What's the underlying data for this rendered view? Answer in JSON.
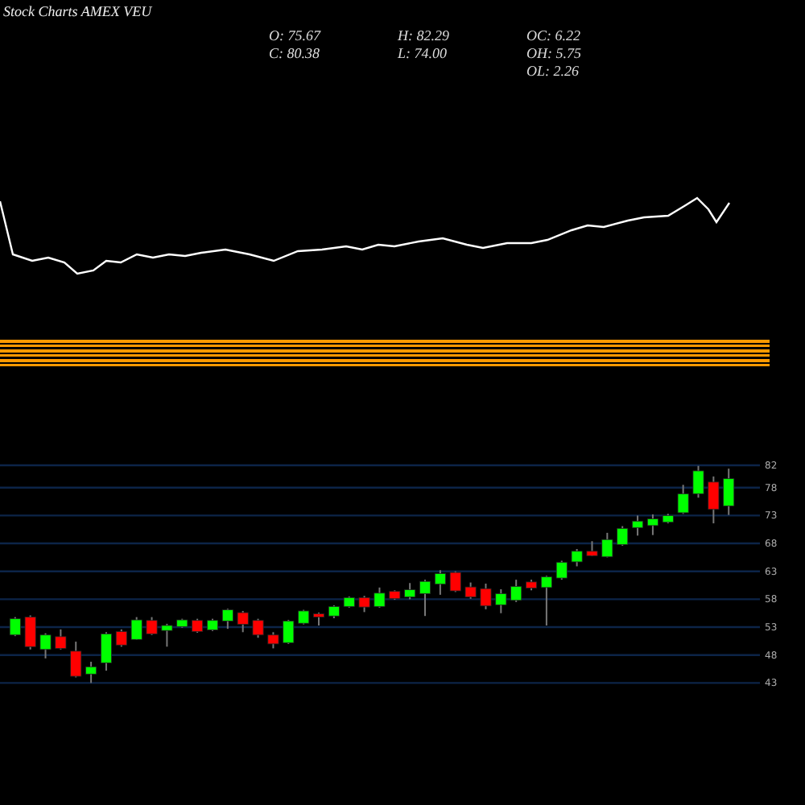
{
  "header": {
    "title": "Stock Charts AMEX  VEU",
    "stats": [
      [
        "O: 75.67",
        "C: 80.38"
      ],
      [
        "H: 82.29",
        "L: 74.00"
      ],
      [
        "OC: 6.22",
        "OH: 5.75",
        "OL: 2.26"
      ]
    ]
  },
  "price_chart": {
    "chart_data": {
      "type": "candlestick",
      "grid": true,
      "ohlc": [
        [
          51.6,
          54.8,
          51.4,
          54.5
        ],
        [
          54.8,
          55.1,
          49.0,
          49.5
        ],
        [
          49.0,
          51.9,
          47.4,
          51.6
        ],
        [
          51.3,
          52.6,
          49.0,
          49.2
        ],
        [
          48.7,
          50.4,
          44.0,
          44.2
        ],
        [
          44.6,
          46.8,
          43.0,
          45.9
        ],
        [
          46.6,
          52.1,
          45.2,
          51.8
        ],
        [
          52.2,
          52.6,
          49.5,
          49.8
        ],
        [
          50.8,
          54.8,
          50.7,
          54.3
        ],
        [
          54.2,
          54.8,
          51.6,
          51.8
        ],
        [
          52.4,
          53.6,
          49.5,
          53.3
        ],
        [
          53.1,
          54.5,
          52.9,
          54.3
        ],
        [
          54.2,
          54.5,
          52.0,
          52.2
        ],
        [
          52.5,
          54.5,
          52.3,
          54.2
        ],
        [
          54.1,
          56.3,
          52.7,
          56.1
        ],
        [
          55.6,
          55.9,
          52.1,
          53.5
        ],
        [
          54.2,
          54.5,
          51.1,
          51.6
        ],
        [
          51.6,
          52.1,
          49.2,
          50.0
        ],
        [
          50.2,
          54.3,
          50.0,
          54.1
        ],
        [
          53.7,
          56.1,
          53.5,
          55.9
        ],
        [
          55.4,
          55.6,
          53.3,
          54.8
        ],
        [
          55.0,
          56.9,
          54.6,
          56.7
        ],
        [
          56.7,
          58.5,
          56.5,
          58.3
        ],
        [
          58.3,
          58.6,
          55.7,
          56.6
        ],
        [
          56.7,
          60.1,
          56.5,
          59.1
        ],
        [
          59.4,
          59.6,
          57.9,
          58.1
        ],
        [
          58.4,
          60.9,
          58.0,
          59.7
        ],
        [
          59.0,
          61.5,
          55.0,
          61.2
        ],
        [
          60.7,
          63.2,
          58.8,
          62.6
        ],
        [
          62.8,
          63.0,
          59.3,
          59.5
        ],
        [
          60.2,
          61.0,
          58.1,
          58.4
        ],
        [
          59.9,
          60.8,
          56.2,
          56.8
        ],
        [
          57.0,
          59.8,
          55.5,
          59.0
        ],
        [
          57.8,
          61.5,
          57.5,
          60.3
        ],
        [
          61.1,
          61.5,
          59.6,
          60.0
        ],
        [
          60.1,
          62.2,
          53.3,
          62.0
        ],
        [
          61.8,
          64.9,
          61.5,
          64.6
        ],
        [
          64.7,
          67.0,
          63.9,
          66.6
        ],
        [
          66.6,
          68.4,
          65.7,
          65.8
        ],
        [
          65.6,
          69.9,
          65.5,
          68.7
        ],
        [
          67.8,
          71.1,
          67.6,
          70.7
        ],
        [
          70.8,
          73.0,
          69.4,
          72.0
        ],
        [
          71.2,
          73.2,
          69.5,
          72.4
        ],
        [
          71.8,
          73.3,
          71.6,
          73.0
        ],
        [
          73.5,
          78.5,
          73.3,
          76.9
        ],
        [
          76.9,
          81.9,
          76.2,
          81.0
        ],
        [
          79.0,
          80.0,
          71.6,
          74.1
        ],
        [
          74.7,
          81.4,
          73.1,
          79.6
        ]
      ],
      "ylim": [
        43,
        82
      ],
      "yticks": [
        {
          "value": 82,
          "label": "82"
        },
        {
          "value": 78,
          "label": "78"
        },
        {
          "value": 73,
          "label": "73"
        },
        {
          "value": 68,
          "label": "68"
        },
        {
          "value": 63,
          "label": "63"
        },
        {
          "value": 58,
          "label": "58"
        },
        {
          "value": 53,
          "label": "53"
        },
        {
          "value": 48,
          "label": "48"
        },
        {
          "value": 43,
          "label": "43"
        }
      ]
    }
  }
}
